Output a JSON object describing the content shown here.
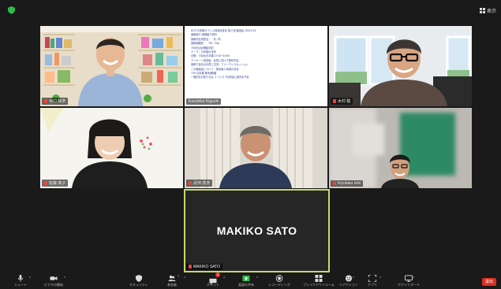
{
  "topbar": {
    "view_label": "表示"
  },
  "participants": [
    {
      "name": "木口 和彦"
    },
    {
      "name": "Kazuhiko Kiguchi"
    },
    {
      "name": "木村 聡"
    },
    {
      "name": "佐藤 真子"
    },
    {
      "name": "武田 亮彦"
    },
    {
      "name": "Kiyotaka Ishii"
    }
  ],
  "active_speaker": {
    "display_name": "MAKIKO SATO",
    "tag": "MAKIKO SATO"
  },
  "shared_doc": {
    "lines": [
      "NCR 日本橋オフィス地域活性化 第 2 回 勉強会 2023.6.24",
      "講師紹介 講師紹介資料",
      "",
      "講師氏名所属名：　氏 / 所",
      "講師連絡先：　TEL / Fax",
      "",
      "7月5日(水)開催決定！",
      "テーマ：日本橋の未来",
      "",
      "日程：7/5(水)日本橋 17:00〜19:00",
      "アンケート回収後、全員に向けて配布予定。",
      "講師で会社の社員と交流・フリーディスカッション",
      "",
      "この勉強会について：参加者と地域の交流",
      "",
      "7/19 日本橋 第3回開催",
      "",
      "一般的なお知らせは メールで 7月末頃に案内を予定"
    ]
  },
  "toolbar": {
    "items": [
      {
        "label": "ミュート",
        "icon": "microphone-icon"
      },
      {
        "label": "ビデオの開始",
        "icon": "video-camera-icon"
      },
      {
        "label": "セキュリティ",
        "icon": "shield-icon"
      },
      {
        "label": "参加者",
        "icon": "participants-icon",
        "count": "7"
      },
      {
        "label": "チャット",
        "icon": "chat-icon",
        "badge": "1"
      },
      {
        "label": "画面の共有",
        "icon": "share-screen-icon"
      },
      {
        "label": "レコーディング",
        "icon": "record-icon"
      },
      {
        "label": "ブレイクアウトルーム",
        "icon": "breakout-rooms-icon"
      },
      {
        "label": "リアクション",
        "icon": "reactions-icon"
      },
      {
        "label": "アプリ",
        "icon": "apps-icon"
      },
      {
        "label": "ホワイトボード",
        "icon": "whiteboard-icon"
      }
    ],
    "leave_label": "退出"
  }
}
